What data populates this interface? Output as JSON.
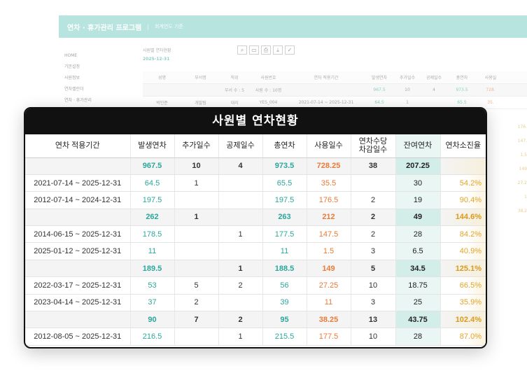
{
  "bg": {
    "app_title": "연차 · 휴가관리 프로그램",
    "separator": "|",
    "app_subtitle": "회계연도 기준",
    "side": [
      "HOME",
      "기본설정",
      "사원정보",
      "연차캘린더",
      "연차 · 휴가관리"
    ],
    "crumb": "사원별 연차현황",
    "date": "2025-12-31",
    "tool_icons": [
      "search-icon",
      "monitor-icon",
      "print-icon",
      "download-icon",
      "check-icon"
    ],
    "tool_glyphs": [
      "⌕",
      "▭",
      "⎙",
      "⤓",
      "✓"
    ],
    "head": [
      "성명",
      "부서명",
      "직위",
      "사원번호",
      "연차 적용기간",
      "발생연차",
      "추가일수",
      "공제일수",
      "총연차",
      "사용일"
    ],
    "sum_row": [
      "",
      "",
      "부서 수 : 5",
      "사원 수 : 10명",
      "",
      "967.5",
      "10",
      "4",
      "973.5",
      "728."
    ],
    "row1": [
      "박민준",
      "개발팀",
      "대리",
      "YES_004",
      "2021-07-14 ~ 2025-12-31",
      "64.5",
      "1",
      "",
      "65.5",
      "35."
    ],
    "right_col": [
      "176.",
      "147.",
      "1.5",
      "149",
      "27.2",
      "1",
      "38.2"
    ]
  },
  "modal": {
    "title": "사원별 연차현황",
    "headers": [
      "연차 적용기간",
      "발생연차",
      "추가일수",
      "공제일수",
      "총연차",
      "사용일수",
      "연차수당\n차감일수",
      "잔여연차",
      "연차소진율"
    ],
    "rows": [
      {
        "type": "sum",
        "cells": [
          "",
          "967.5",
          "10",
          "4",
          "973.5",
          "728.25",
          "38",
          "207.25",
          ""
        ]
      },
      {
        "type": "row",
        "cells": [
          "2021-07-14 ~ 2025-12-31",
          "64.5",
          "1",
          "",
          "65.5",
          "35.5",
          "",
          "30",
          "54.2%"
        ]
      },
      {
        "type": "row",
        "cells": [
          "2012-07-14 ~ 2024-12-31",
          "197.5",
          "",
          "",
          "197.5",
          "176.5",
          "2",
          "19",
          "90.4%"
        ]
      },
      {
        "type": "sum",
        "cells": [
          "",
          "262",
          "1",
          "",
          "263",
          "212",
          "2",
          "49",
          "144.6%"
        ]
      },
      {
        "type": "row",
        "cells": [
          "2014-06-15 ~ 2025-12-31",
          "178.5",
          "",
          "1",
          "177.5",
          "147.5",
          "2",
          "28",
          "84.2%"
        ]
      },
      {
        "type": "row",
        "cells": [
          "2025-01-12 ~ 2025-12-31",
          "11",
          "",
          "",
          "11",
          "1.5",
          "3",
          "6.5",
          "40.9%"
        ]
      },
      {
        "type": "sum",
        "cells": [
          "",
          "189.5",
          "",
          "1",
          "188.5",
          "149",
          "5",
          "34.5",
          "125.1%"
        ]
      },
      {
        "type": "row",
        "cells": [
          "2022-03-17 ~ 2025-12-31",
          "53",
          "5",
          "2",
          "56",
          "27.25",
          "10",
          "18.75",
          "66.5%"
        ]
      },
      {
        "type": "row",
        "cells": [
          "2023-04-14 ~ 2025-12-31",
          "37",
          "2",
          "",
          "39",
          "11",
          "3",
          "25",
          "35.9%"
        ]
      },
      {
        "type": "sum",
        "cells": [
          "",
          "90",
          "7",
          "2",
          "95",
          "38.25",
          "13",
          "43.75",
          "102.4%"
        ]
      },
      {
        "type": "row",
        "cells": [
          "2012-08-05 ~ 2025-12-31",
          "216.5",
          "",
          "1",
          "215.5",
          "177.5",
          "10",
          "28",
          "87.0%"
        ]
      }
    ]
  },
  "colors": {
    "header_teal": "#7ecfc6",
    "accent_teal": "#2aa79b",
    "used_orange": "#ea7a37",
    "rate_gold": "#e1a427",
    "remain_bg": "#eaf6f4"
  }
}
